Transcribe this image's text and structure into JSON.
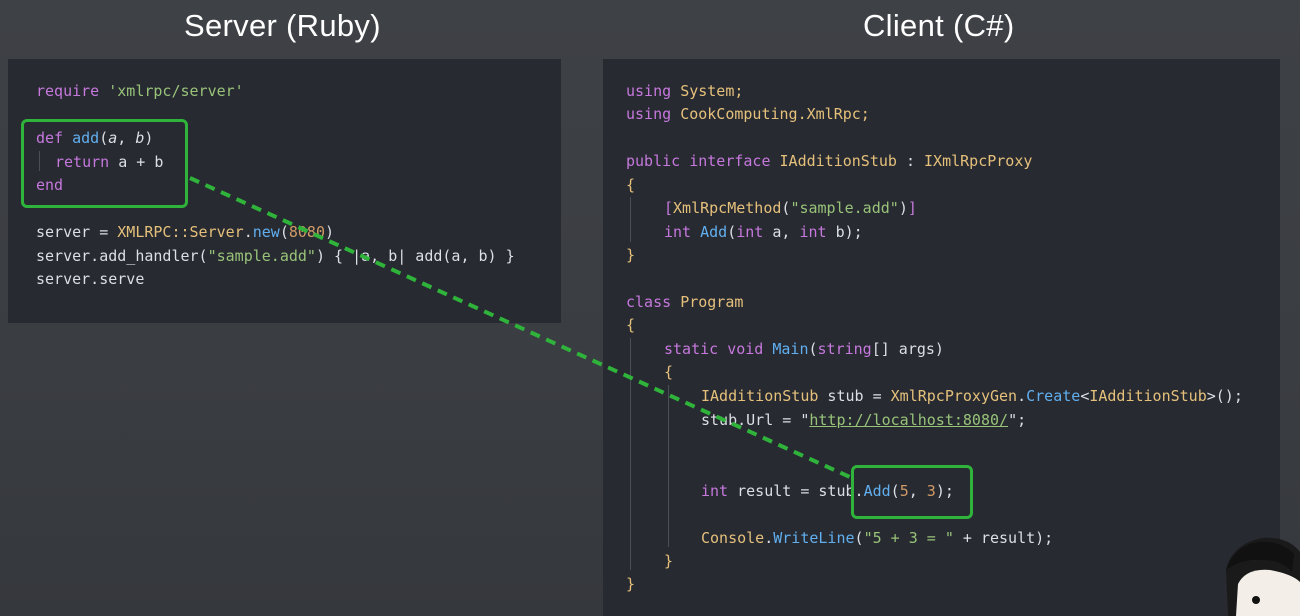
{
  "titles": {
    "server": "Server (Ruby)",
    "client": "Client (C#)"
  },
  "server": {
    "line1": {
      "kw": "require",
      "str": "'xmlrpc/server'"
    },
    "line2": {
      "kw": "def",
      "fn": "add",
      "open": "(",
      "p1": "a",
      "comma": ", ",
      "p2": "b",
      "close": ")"
    },
    "line3": {
      "kw": "return",
      "expr": "a + b"
    },
    "line4": {
      "kw": "end"
    },
    "line5": {
      "lhs": "server = ",
      "typ": "XMLRPC::Server",
      "dot": ".",
      "fn": "new",
      "open": "(",
      "num": "8080",
      "close": ")"
    },
    "line6": {
      "pre": "server.add_handler(",
      "str": "\"sample.add\"",
      "post": ") { |a, b| add(a, b) }"
    },
    "line7": {
      "text": "server.serve"
    }
  },
  "client": {
    "l1": {
      "kw": "using",
      "rest": "System;"
    },
    "l2": {
      "kw": "using",
      "rest": "CookComputing.XmlRpc;"
    },
    "l3": {
      "kw": "public interface",
      "typ": "IAdditionStub",
      "sep": " : ",
      "typ2": "IXmlRpcProxy"
    },
    "l4": {
      "brace": "{"
    },
    "l5": {
      "open": "[",
      "typ": "XmlRpcMethod",
      "po": "(",
      "str": "\"sample.add\"",
      "pc": ")",
      "close": "]"
    },
    "l6": {
      "kw": "int",
      "fn": "Add",
      "open": "(",
      "kw2": "int",
      "a": " a, ",
      "kw3": "int",
      "b": " b);"
    },
    "l7": {
      "brace": "}"
    },
    "l8": {
      "kw": "class",
      "typ": "Program"
    },
    "l9": {
      "brace": "{"
    },
    "l10": {
      "kw": "static void",
      "fn": "Main",
      "open": "(",
      "kw2": "string",
      "rest": "[] args)"
    },
    "l11": {
      "brace": "{"
    },
    "l12": {
      "typ": "IAdditionStub",
      "var": " stub = ",
      "typ2": "XmlRpcProxyGen",
      "dot": ".",
      "fn": "Create",
      "gen_open": "<",
      "typ3": "IAdditionStub",
      "gen_close": ">();"
    },
    "l13": {
      "pre": "stub.Url = \"",
      "url": "http://localhost:8080/",
      "post": "\";"
    },
    "l14": {
      "kw": "int",
      "var": " result = stub.",
      "fn": "Add",
      "open": "(",
      "n1": "5",
      "comma": ", ",
      "n2": "3",
      "close": ");"
    },
    "l15": {
      "typ": "Console",
      "dot": ".",
      "fn": "WriteLine",
      "open": "(",
      "str": "\"5 + 3 = \"",
      "rest": " + result);"
    },
    "l16": {
      "brace": "}"
    },
    "l17": {
      "brace": "}"
    }
  },
  "colors": {
    "highlight_box": "#2fb33a",
    "arrow": "#2fb33a"
  }
}
